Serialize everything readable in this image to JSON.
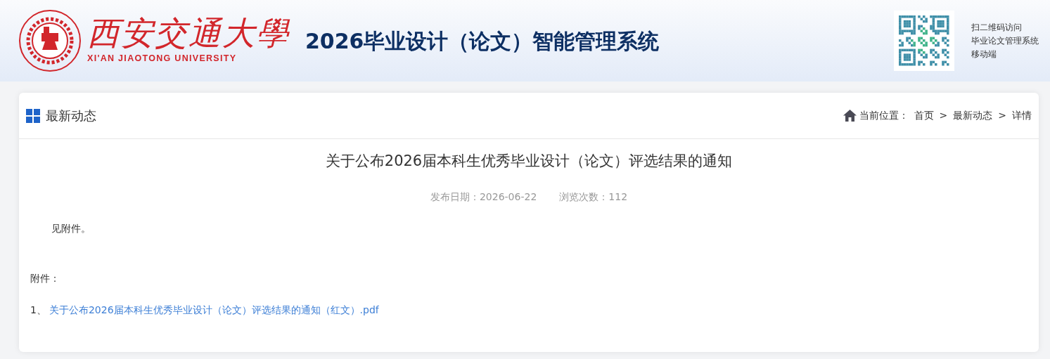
{
  "header": {
    "logo_cn": "西安交通大學",
    "logo_en": "XI'AN JIAOTONG UNIVERSITY",
    "system_title": "2026毕业设计（论文）智能管理系统",
    "qr_caption": [
      "扫二维码访问",
      "毕业论文管理系统",
      "移动端"
    ]
  },
  "panel": {
    "title": "最新动态",
    "breadcrumb_label": "当前位置：",
    "breadcrumb": [
      {
        "label": "首页",
        "kind": "link"
      },
      {
        "label": ">",
        "kind": "separator"
      },
      {
        "label": "最新动态",
        "kind": "link"
      },
      {
        "label": ">",
        "kind": "separator"
      },
      {
        "label": "详情",
        "kind": "current"
      }
    ]
  },
  "article": {
    "title": "关于公布2026届本科生优秀毕业设计（论文）评选结果的通知",
    "publish_date": "发布日期：2026-06-22",
    "views": "浏览次数：112",
    "body": "见附件。",
    "attachments_label": "附件：",
    "attachments": [
      {
        "index": "1、",
        "name": "关于公布2026届本科生优秀毕业设计（论文）评选结果的通知（红文）.pdf"
      }
    ]
  }
}
